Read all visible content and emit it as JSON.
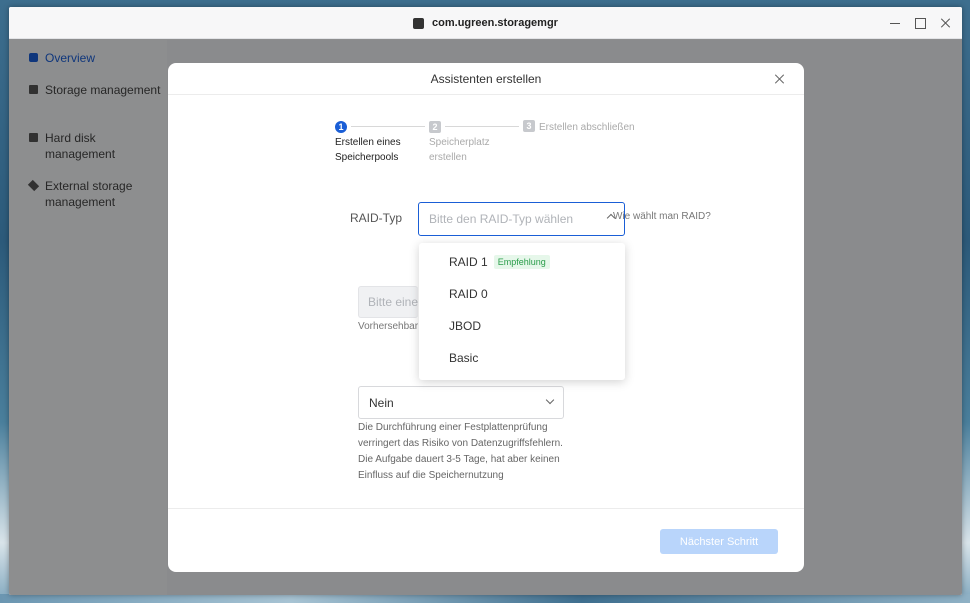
{
  "window": {
    "title": "com.ugreen.storagemgr"
  },
  "sidebar": {
    "items": [
      {
        "label": "Overview",
        "icon": "overview-icon",
        "active": true
      },
      {
        "label": "Storage management",
        "icon": "storage-icon"
      },
      {
        "label": "Hard disk management",
        "icon": "hard-disk-icon"
      },
      {
        "label": "External storage management",
        "icon": "external-storage-icon"
      }
    ]
  },
  "dialog": {
    "title": "Assistenten erstellen",
    "steps": [
      {
        "num": "1",
        "label": "Erstellen eines Speicherpools"
      },
      {
        "num": "2",
        "label": "Speicherplatz erstellen"
      },
      {
        "num": "3",
        "label": "Erstellen abschließen"
      }
    ],
    "raid": {
      "label": "RAID-Typ",
      "placeholder": "Bitte den RAID-Typ wählen",
      "help": "Wie wählt man RAID?"
    },
    "capacity": {
      "placeholder": "Bitte eine",
      "note": "Vorhersehbare"
    },
    "dropdown": {
      "options": [
        {
          "label": "RAID 1",
          "badge": "Empfehlung"
        },
        {
          "label": "RAID 0"
        },
        {
          "label": "JBOD"
        },
        {
          "label": "Basic"
        }
      ]
    },
    "check": {
      "value": "Nein",
      "description": "Die Durchführung einer Festplattenprüfung verringert das Risiko von Datenzugriffsfehlern. Die Aufgabe dauert 3-5 Tage, hat aber keinen Einfluss auf die Speichernutzung"
    },
    "next_label": "Nächster Schritt"
  },
  "colors": {
    "accent": "#1a5ed6",
    "badge_bg": "#e6f7ea",
    "badge_fg": "#2a9d4a",
    "disabled_button": "#b9d5fb"
  }
}
